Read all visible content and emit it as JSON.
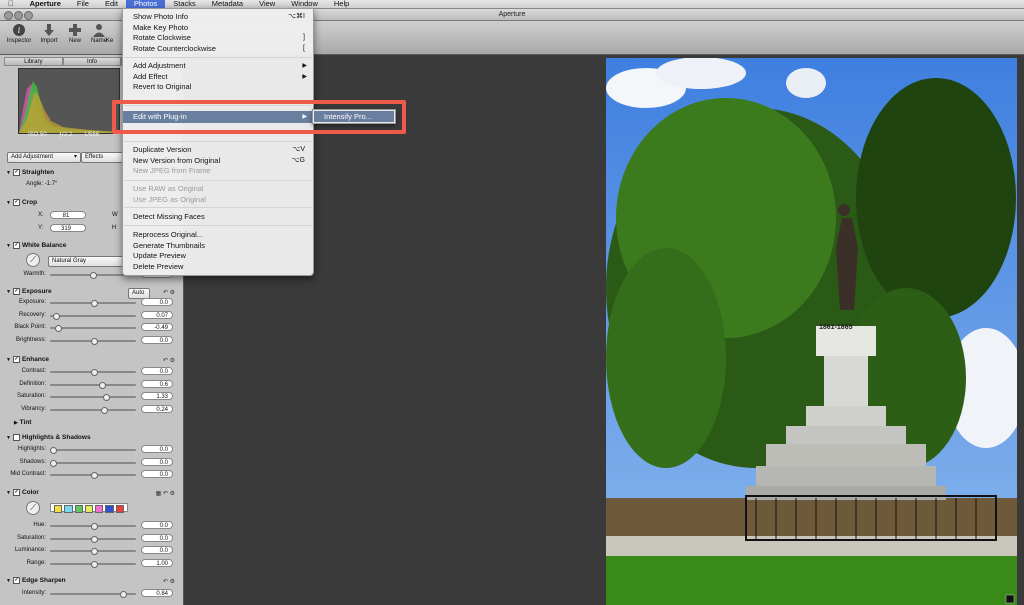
{
  "menubar": {
    "app": "Aperture",
    "items": [
      "File",
      "Edit",
      "Photos",
      "Stacks",
      "Metadata",
      "View",
      "Window",
      "Help"
    ]
  },
  "window_title": "Aperture",
  "toolbar": {
    "inspector": "Inspector",
    "import": "Import",
    "new": "New",
    "name": "Name",
    "ke": "Ke"
  },
  "inspector_tabs": [
    "Library",
    "Info"
  ],
  "histogram_info": [
    "ISO 50",
    "ƒ/2.2",
    "1/586"
  ],
  "adjust": {
    "add_adjustment": "Add Adjustment",
    "effects": "Effects"
  },
  "straighten": {
    "title": "Straighten",
    "angle_label": "Angle:",
    "angle_value": "-1.7°"
  },
  "crop": {
    "title": "Crop",
    "x_label": "X:",
    "x_value": "81",
    "y_label": "Y:",
    "y_value": "319",
    "w_label": "W",
    "h_label": "H"
  },
  "white_balance": {
    "title": "White Balance",
    "mode": "Natural Gray",
    "warmth_label": "Warmth:",
    "warmth_value": "0.50"
  },
  "exposure": {
    "title": "Exposure",
    "auto": "Auto",
    "rows": [
      {
        "label": "Exposure:",
        "value": "0.0",
        "pos": 0.5
      },
      {
        "label": "Recovery:",
        "value": "0.07",
        "pos": 0.04
      },
      {
        "label": "Black Point:",
        "value": "-0.49",
        "pos": 0.06
      },
      {
        "label": "Brightness:",
        "value": "0.0",
        "pos": 0.5
      }
    ]
  },
  "enhance": {
    "title": "Enhance",
    "rows": [
      {
        "label": "Contrast:",
        "value": "0.0",
        "pos": 0.5
      },
      {
        "label": "Definition:",
        "value": "0.6",
        "pos": 0.6
      },
      {
        "label": "Saturation:",
        "value": "1.33",
        "pos": 0.65
      },
      {
        "label": "Vibrancy:",
        "value": "0.24",
        "pos": 0.62
      }
    ],
    "tint": "Tint"
  },
  "highlights_shadows": {
    "title": "Highlights & Shadows",
    "rows": [
      {
        "label": "Highlights:",
        "value": "0.0",
        "pos": 0.0
      },
      {
        "label": "Shadows:",
        "value": "0.0",
        "pos": 0.0
      },
      {
        "label": "Mid Contrast:",
        "value": "0.0",
        "pos": 0.5
      }
    ]
  },
  "color": {
    "title": "Color",
    "swatches": [
      "#f0e040",
      "#7ad8f0",
      "#60c860",
      "#e8e860",
      "#f070d0",
      "#3050d0",
      "#e84040"
    ],
    "rows": [
      {
        "label": "Hue:",
        "value": "0.0",
        "pos": 0.5
      },
      {
        "label": "Saturation:",
        "value": "0.0",
        "pos": 0.5
      },
      {
        "label": "Luminance:",
        "value": "0.0",
        "pos": 0.5
      },
      {
        "label": "Range:",
        "value": "1.00",
        "pos": 0.5
      }
    ]
  },
  "edge_sharpen": {
    "title": "Edge Sharpen",
    "intensity_label": "Intensity:",
    "intensity_value": "0.84"
  },
  "photos_menu": {
    "items": [
      {
        "label": "Show Photo Info",
        "shortcut": "⌥⌘I",
        "disabled": false
      },
      {
        "label": "Make Key Photo",
        "shortcut": "",
        "disabled": false
      },
      {
        "label": "Rotate Clockwise",
        "shortcut": "]",
        "disabled": false
      },
      {
        "label": "Rotate Counterclockwise",
        "shortcut": "[",
        "disabled": false
      },
      {
        "label": "Add Adjustment",
        "shortcut": "",
        "disabled": false,
        "submenu": true
      },
      {
        "label": "Add Effect",
        "shortcut": "",
        "disabled": false,
        "submenu": true
      },
      {
        "label": "Revert to Original",
        "shortcut": "",
        "disabled": false
      },
      {
        "label": "Edit with Plug-in",
        "shortcut": "",
        "disabled": false,
        "submenu": true,
        "highlighted": true
      },
      {
        "label": "Duplicate Version",
        "shortcut": "⌥V",
        "disabled": false
      },
      {
        "label": "New Version from Original",
        "shortcut": "⌥G",
        "disabled": false
      },
      {
        "label": "New JPEG from Frame",
        "shortcut": "",
        "disabled": true
      },
      {
        "label": "Use RAW as Original",
        "shortcut": "",
        "disabled": true
      },
      {
        "label": "Use JPEG as Original",
        "shortcut": "",
        "disabled": true
      },
      {
        "label": "Detect Missing Faces",
        "shortcut": "",
        "disabled": false
      },
      {
        "label": "Reprocess Original...",
        "shortcut": "",
        "disabled": false
      },
      {
        "label": "Generate Thumbnails",
        "shortcut": "",
        "disabled": false
      },
      {
        "label": "Update Preview",
        "shortcut": "",
        "disabled": false
      },
      {
        "label": "Delete Preview",
        "shortcut": "",
        "disabled": false
      }
    ]
  },
  "submenu": {
    "item": "Intensify Pro..."
  },
  "monument_text": "1861-1865",
  "colors": {
    "highlight": "#6a7ea0",
    "callout": "#f05a4a",
    "menubar_active": "#4a6fd8"
  }
}
